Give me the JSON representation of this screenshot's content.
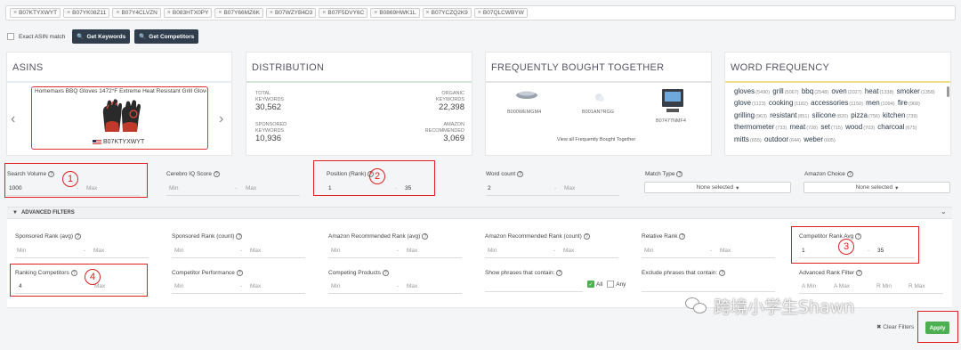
{
  "asin_chips": [
    "B07KTYXWYT",
    "B07YK08Z11",
    "B07Y4CLVZN",
    "B083HTX0PY",
    "B07Y66MZ6K",
    "B07WZYB4D3",
    "B07F5DVY6C",
    "B0869HWK1L",
    "B07YCZQ2K9",
    "B07QLCWBYW"
  ],
  "exact_match_label": "Exact ASIN match",
  "buttons": {
    "get_keywords": "Get Keywords",
    "get_competitors": "Get Competitors",
    "clear_filters": "Clear Filters",
    "apply": "Apply"
  },
  "cards": {
    "asins": {
      "title": "ASINS",
      "product_title": "Homemaxs BBQ Gloves 1472°F Extreme Heat Resistant Grill Gloves...",
      "product_asin": "B07KTYXWYT"
    },
    "distribution": {
      "title": "DISTRIBUTION",
      "total_keywords_label": [
        "TOTAL",
        "KEYWORDS"
      ],
      "total_keywords": "30,562",
      "organic_keywords_label": [
        "ORGANIC",
        "KEYWORDS"
      ],
      "organic_keywords": "22,398",
      "sponsored_keywords_label": [
        "SPONSORED",
        "KEYWORDS"
      ],
      "sponsored_keywords": "10,936",
      "amazon_recommended_label": [
        "AMAZON",
        "RECOMMENDED"
      ],
      "amazon_recommended": "3,069"
    },
    "fbt": {
      "title": "FREQUENTLY BOUGHT TOGETHER",
      "items": [
        "B000WEMGM4",
        "B001AN7RGG",
        "B07477NMF4"
      ],
      "view_all": "View all Frequently Bought Together"
    },
    "word_frequency": {
      "title": "WORD FREQUENCY",
      "words": [
        [
          "gloves",
          "(5490)"
        ],
        [
          "grill",
          "(5067)"
        ],
        [
          "bbq",
          "(2548)"
        ],
        [
          "oven",
          "(2027)"
        ],
        [
          "heat",
          "(1338)"
        ],
        [
          "smoker",
          "(1358)"
        ],
        [
          "glove",
          "(1123)"
        ],
        [
          "cooking",
          "(1182)"
        ],
        [
          "accessories",
          "(1150)"
        ],
        [
          "men",
          "(1094)"
        ],
        [
          "fire",
          "(968)"
        ],
        [
          "grilling",
          "(963)"
        ],
        [
          "resistant",
          "(851)"
        ],
        [
          "silicone",
          "(820)"
        ],
        [
          "pizza",
          "(756)"
        ],
        [
          "kitchen",
          "(739)"
        ],
        [
          "thermometer",
          "(733)"
        ],
        [
          "meat",
          "(728)"
        ],
        [
          "set",
          "(715)"
        ],
        [
          "wood",
          "(703)"
        ],
        [
          "charcoal",
          "(675)"
        ],
        [
          "mitts",
          "(655)"
        ],
        [
          "outdoor",
          "(644)"
        ],
        [
          "weber",
          "(605)"
        ]
      ]
    }
  },
  "filters": {
    "search_volume": {
      "label": "Search Volume",
      "min": "1000",
      "max_ph": "Max"
    },
    "cerebro_iq": {
      "label": "Cerebro IQ Score",
      "min_ph": "Min",
      "max_ph": "Max"
    },
    "position_rank": {
      "label": "Position (Rank)",
      "min": "1",
      "max": "35"
    },
    "word_count": {
      "label": "Word count",
      "min": "2",
      "max_ph": "Max"
    },
    "match_type": {
      "label": "Match Type",
      "selected": "None selected"
    },
    "amazon_choice": {
      "label": "Amazon Choice",
      "selected": "None selected"
    }
  },
  "advanced": {
    "header": "ADVANCED FILTERS",
    "sponsored_rank_avg": {
      "label": "Sponsored Rank (avg)",
      "min_ph": "Min",
      "max_ph": "Max"
    },
    "sponsored_rank_count": {
      "label": "Sponsored Rank (count)",
      "min_ph": "Min",
      "max_ph": "Max"
    },
    "amazon_rec_rank_avg": {
      "label": "Amazon Recommended Rank (avg)",
      "min_ph": "Min",
      "max_ph": "Max"
    },
    "amazon_rec_rank_count": {
      "label": "Amazon Recommended Rank (count)",
      "min_ph": "Min",
      "max_ph": "Max"
    },
    "relative_rank": {
      "label": "Relative Rank",
      "min_ph": "Min",
      "max_ph": "Max"
    },
    "competitor_rank_avg": {
      "label": "Competitor Rank Avg",
      "min": "1",
      "max": "35"
    },
    "ranking_competitors": {
      "label": "Ranking Competitors",
      "min": "4",
      "max_ph": "Max"
    },
    "competitor_performance": {
      "label": "Competitor Performance",
      "min_ph": "Min",
      "max_ph": "Max"
    },
    "competing_products": {
      "label": "Competing Products",
      "min_ph": "Min",
      "max_ph": "Max"
    },
    "show_phrases": {
      "label": "Show phrases that contain:",
      "all": "All",
      "any": "Any"
    },
    "exclude_phrases": {
      "label": "Exclude phrases that contain:"
    },
    "advanced_rank_filter": {
      "label": "Advanced Rank Filter",
      "cols": [
        "A Min",
        "A Max",
        "R Min",
        "R Max"
      ]
    }
  },
  "annotations": [
    "1",
    "2",
    "3",
    "4"
  ],
  "watermark": "跨境小学生Shawn",
  "colors": {
    "accent_red": "#e02020",
    "apply_green": "#4caf50",
    "button_dark": "#2f3d4c"
  }
}
